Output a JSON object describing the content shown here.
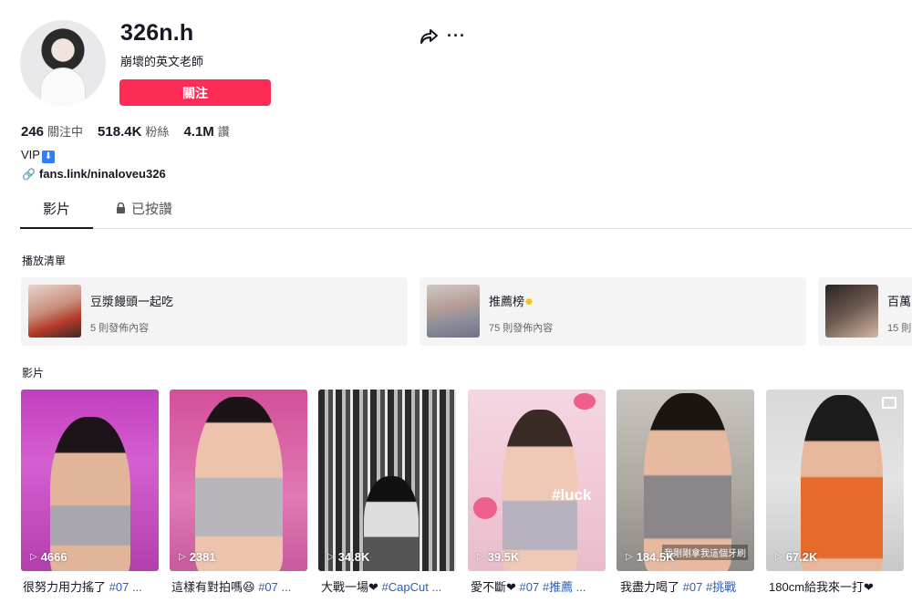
{
  "profile": {
    "username": "326n.h",
    "nickname": "崩壞的英文老師",
    "follow_label": "關注",
    "stats": [
      {
        "value": "246",
        "label": "關注中"
      },
      {
        "value": "518.4K",
        "label": "粉絲"
      },
      {
        "value": "4.1M",
        "label": "讚"
      }
    ],
    "bio": "VIP",
    "bio_badge": "⬇",
    "link": "fans.link/ninaloveu326"
  },
  "tabs": {
    "videos": "影片",
    "liked": "已按讚"
  },
  "playlists": {
    "title": "播放清單",
    "items": [
      {
        "name": "豆漿饅頭一起吃",
        "count": "5 則發佈內容"
      },
      {
        "name": "推薦榜",
        "count": "75 則發佈內容"
      },
      {
        "name": "百萬",
        "count": "15 則"
      }
    ]
  },
  "videos": {
    "title": "影片",
    "items": [
      {
        "views": "4666",
        "caption": "很努力用力搖了",
        "tag": "#07 ..."
      },
      {
        "views": "2381",
        "caption": "這樣有對拍嗎😆",
        "tag": "#07 ..."
      },
      {
        "views": "34.8K",
        "caption": "大戰一場❤",
        "tag": "#CapCut ..."
      },
      {
        "views": "39.5K",
        "caption": "愛不斷❤",
        "tag": "#07 #推薦 ..."
      },
      {
        "views": "184.5K",
        "caption": "我盡力喝了",
        "tag": "#07 #挑戰"
      },
      {
        "views": "67.2K",
        "caption": "180cm給我來一打❤",
        "tag": ""
      }
    ]
  },
  "overlays": {
    "luck_text": "#luck",
    "subtitle_text": "我剛剛拿我這個牙刷"
  },
  "colors": {
    "accent": "#fe2c55",
    "hashtag": "#2b5db9"
  }
}
